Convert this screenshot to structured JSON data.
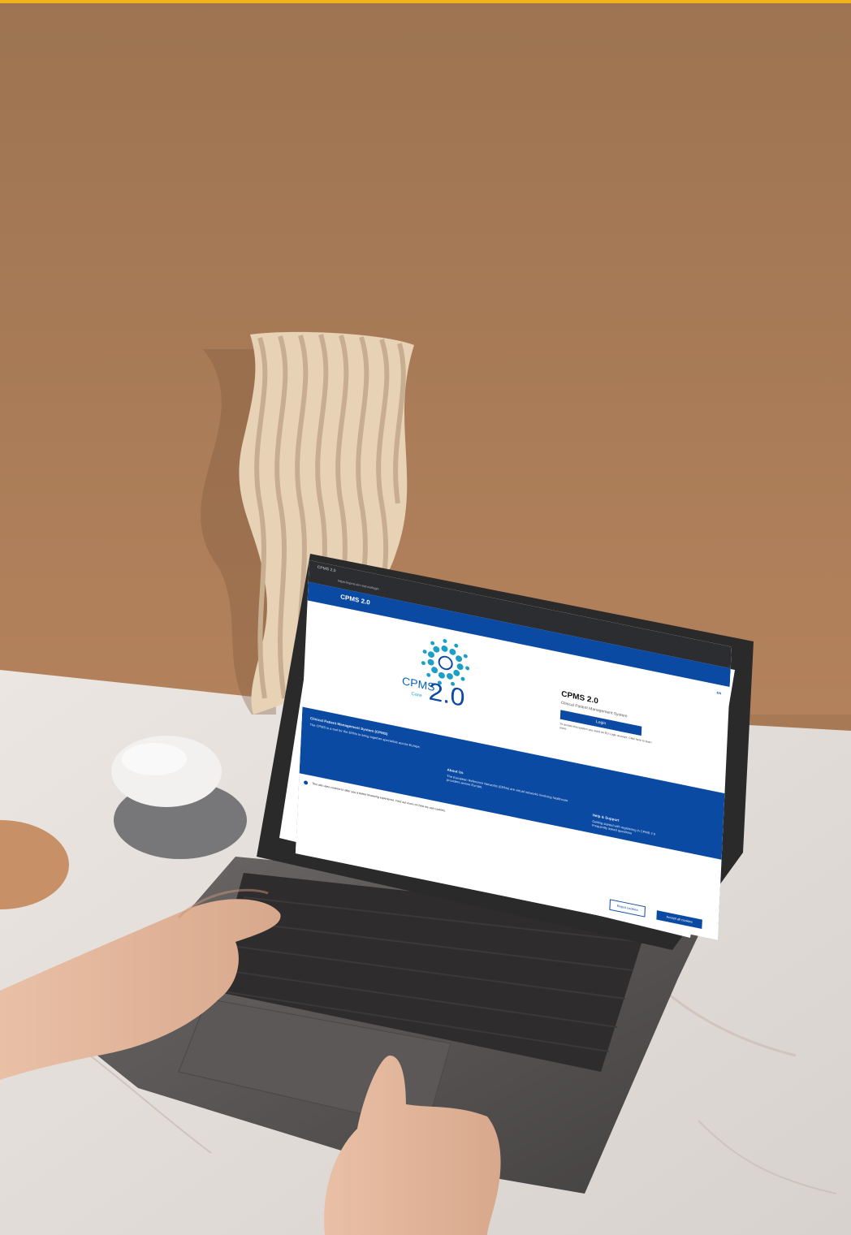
{
  "colors": {
    "wall": "#a77a55",
    "marble": "#e3dfdc",
    "laptop": "#5b5756",
    "accent_blue": "#0b4aa2",
    "top_bar": "#f1b31c"
  },
  "browser": {
    "tab_title": "CPMS 2.0",
    "url": "https://cpms.ern-net.eu/login"
  },
  "header": {
    "title": "CPMS 2.0",
    "lang": "EN"
  },
  "logo": {
    "cpms": "CPMS",
    "core": "Core",
    "version": "2.0"
  },
  "login": {
    "title": "CPMS 2.0",
    "subtitle": "Clinical Patient Management System",
    "button": "Login",
    "note": "To access this system you need an EU Login account. Click here to learn more."
  },
  "footer": {
    "col1_heading": "Clinical Patient Management System (CPMS)",
    "col1_text": "The CPMS is a tool for the ERNs to bring together specialists across Europe.",
    "col2_heading": "About Us",
    "col2_text": "The European Reference Networks (ERNs) are virtual networks involving healthcare providers across Europe.",
    "col3_heading": "Help & Support",
    "col3_text": "Getting started with registering in CPMS 2.0",
    "col3_text2": "Frequently asked questions"
  },
  "cookie": {
    "text": "This site uses cookies to offer you a better browsing experience. Find out more on how we use cookies.",
    "reject": "Reject cookies",
    "accept": "Accept all cookies"
  }
}
